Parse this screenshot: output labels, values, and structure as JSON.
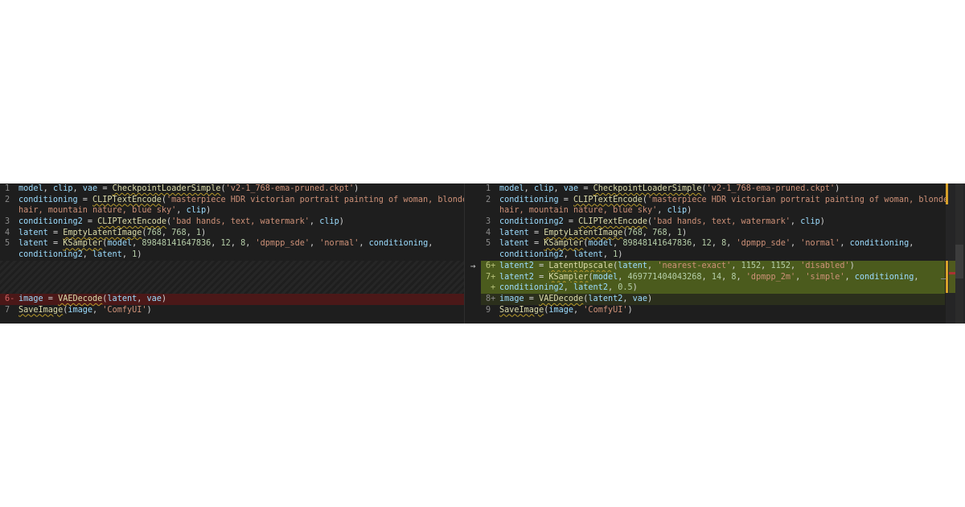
{
  "left": {
    "lines": [
      {
        "n": "1",
        "text": "model, clip, vae = CheckpointLoaderSimple('v2-1_768-ema-pruned.ckpt')"
      },
      {
        "n": "2",
        "text": "conditioning = CLIPTextEncode('masterpiece HDR victorian portrait painting of woman, blonde"
      },
      {
        "n": "",
        "text": "hair, mountain nature, blue sky', clip)"
      },
      {
        "n": "3",
        "text": "conditioning2 = CLIPTextEncode('bad hands, text, watermark', clip)"
      },
      {
        "n": "4",
        "text": "latent = EmptyLatentImage(768, 768, 1)"
      },
      {
        "n": "5",
        "text": "latent = KSampler(model, 89848141647836, 12, 8, 'dpmpp_sde', 'normal', conditioning,"
      },
      {
        "n": "",
        "text": "conditioning2, latent, 1)"
      },
      {
        "n": "6-",
        "text": "image = VAEDecode(latent, vae)"
      },
      {
        "n": "7",
        "text": "SaveImage(image, 'ComfyUI')"
      }
    ]
  },
  "right": {
    "lines": [
      {
        "n": "1",
        "text": "model, clip, vae = CheckpointLoaderSimple('v2-1_768-ema-pruned.ckpt')"
      },
      {
        "n": "2",
        "text": "conditioning = CLIPTextEncode('masterpiece HDR victorian portrait painting of woman, blonde"
      },
      {
        "n": "",
        "text": "hair, mountain nature, blue sky', clip)"
      },
      {
        "n": "3",
        "text": "conditioning2 = CLIPTextEncode('bad hands, text, watermark', clip)"
      },
      {
        "n": "4",
        "text": "latent = EmptyLatentImage(768, 768, 1)"
      },
      {
        "n": "5",
        "text": "latent = KSampler(model, 89848141647836, 12, 8, 'dpmpp_sde', 'normal', conditioning,"
      },
      {
        "n": "",
        "text": "conditioning2, latent, 1)"
      },
      {
        "n": "6+",
        "text": "latent2 = LatentUpscale(latent, 'nearest-exact', 1152, 1152, 'disabled')"
      },
      {
        "n": "7+",
        "text": "latent2 = KSampler(model, 469771404043268, 14, 8, 'dpmpp_2m', 'simple', conditioning,"
      },
      {
        "n": "+",
        "text": "conditioning2, latent2, 0.5)"
      },
      {
        "n": "8+",
        "text": "image = VAEDecode(latent2, vae)"
      },
      {
        "n": "9",
        "text": "SaveImage(image, 'ComfyUI')"
      }
    ]
  },
  "arrow_glyph": "→",
  "colors": {
    "editor_bg": "#1e1e1e",
    "deleted_bg": "#4b1818",
    "inserted_bg": "#4b5b1d",
    "variable": "#9cdcfe",
    "function": "#dcdcaa",
    "string": "#ce9178",
    "number": "#b5cea8"
  }
}
